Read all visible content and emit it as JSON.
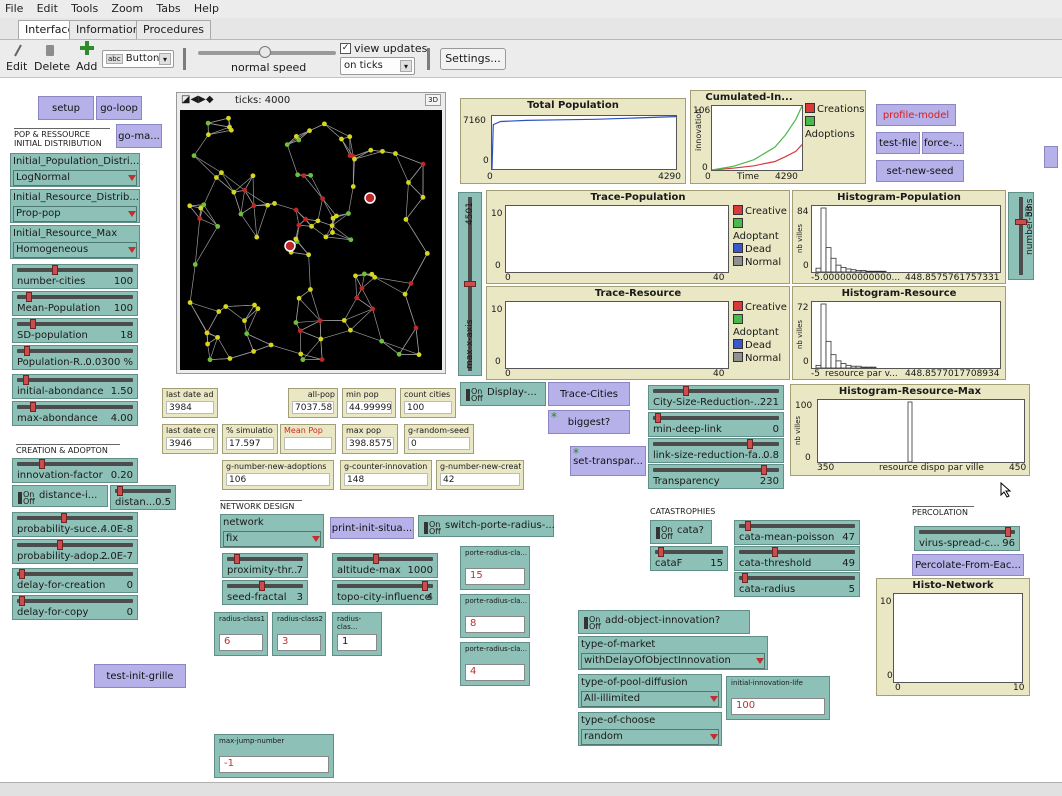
{
  "menu": [
    "File",
    "Edit",
    "Tools",
    "Zoom",
    "Tabs",
    "Help"
  ],
  "tabs": [
    "Interface",
    "Information",
    "Procedures"
  ],
  "toolbar": {
    "edit": "Edit",
    "delete": "Delete",
    "add": "Add",
    "widget_type": "Button",
    "speed_label": "normal speed",
    "view_updates": "view updates",
    "update_mode": "on ticks",
    "settings": "Settings..."
  },
  "world": {
    "ticks_label": "ticks: 4000",
    "three_d": "3D"
  },
  "buttons": {
    "setup": "setup",
    "go_loop": "go-loop",
    "go_ma": "go-ma...",
    "profile_model": "profile-model",
    "test_file": "test-file",
    "force": "force-...",
    "set_new_seed": "set-new-seed",
    "trace_cities": "Trace-Cities",
    "biggest": "biggest?",
    "set_transpar": "set-transpar...",
    "print_init": "print-init-situa...",
    "percolate": "Percolate-From-Eac...",
    "test_init_grille": "test-init-grille"
  },
  "notes": {
    "pop_ressource": "POP & RESSOURCE",
    "initial_distribution": "INITIAL DISTRIBUTION",
    "creation_adoption": "CREATION & ADOPTON",
    "network_design": "NETWORK DESIGN",
    "catastrophies": "CATASTROPHIES",
    "percolation": "PERCOLATION"
  },
  "choosers": {
    "init_pop": {
      "label": "Initial_Population_Distri...",
      "value": "LogNormal"
    },
    "init_res": {
      "label": "Initial_Resource_Distrib...",
      "value": "Prop-pop"
    },
    "init_res_max": {
      "label": "Initial_Resource_Max",
      "value": "Homogeneous"
    },
    "network": {
      "label": "network",
      "value": "fix"
    },
    "type_market": {
      "label": "type-of-market",
      "value": "withDelayOfObjectInnovation"
    },
    "pool_diffusion": {
      "label": "type-of-pool-diffusion",
      "value": "All-illimited"
    },
    "type_choose": {
      "label": "type-of-choose",
      "value": "random"
    }
  },
  "sliders": {
    "number_cities": {
      "name": "number-cities",
      "value": "100",
      "pos": 0.32
    },
    "mean_population": {
      "name": "Mean-Population",
      "value": "100",
      "pos": 0.08
    },
    "sd_population": {
      "name": "SD-population",
      "value": "18",
      "pos": 0.12
    },
    "population_r": {
      "name": "Population-R...",
      "value": "0.0300 %",
      "pos": 0.06
    },
    "initial_abondance": {
      "name": "initial-abondance",
      "value": "1.50",
      "pos": 0.05
    },
    "max_abondance": {
      "name": "max-abondance",
      "value": "4.00",
      "pos": 0.12
    },
    "innovation_factor": {
      "name": "innovation-factor",
      "value": "0.20",
      "pos": 0.2
    },
    "distan": {
      "name": "distan...",
      "value": "0.5",
      "pos": 0.04
    },
    "prob_succ": {
      "name": "probability-suce...",
      "value": "4.0E-8",
      "pos": 0.4
    },
    "prob_adop": {
      "name": "probability-adop...",
      "value": "2.0E-7",
      "pos": 0.36
    },
    "delay_creation": {
      "name": "delay-for-creation",
      "value": "0",
      "pos": 0.02
    },
    "delay_copy": {
      "name": "delay-for-copy",
      "value": "0",
      "pos": 0.02
    },
    "proximity": {
      "name": "proximity-thr...",
      "value": "7",
      "pos": 0.1
    },
    "seed_fractal": {
      "name": "seed-fractal",
      "value": "3",
      "pos": 0.45
    },
    "altitude_max": {
      "name": "altitude-max",
      "value": "1000",
      "pos": 0.4
    },
    "topo_city": {
      "name": "topo-city-influence",
      "value": "4",
      "pos": 0.94
    },
    "city_size_red": {
      "name": "City-Size-Reduction-...",
      "value": "221",
      "pos": 0.25
    },
    "min_deep_link": {
      "name": "min-deep-link",
      "value": "0",
      "pos": 0.02
    },
    "link_size_red": {
      "name": "link-size-reduction-fa...",
      "value": "0.8",
      "pos": 0.78
    },
    "transparency": {
      "name": "Transparency",
      "value": "230",
      "pos": 0.9
    },
    "cata_mean_poisson": {
      "name": "cata-mean-poisson",
      "value": "47",
      "pos": 0.05
    },
    "cata_threshold": {
      "name": "cata-threshold",
      "value": "49",
      "pos": 0.3
    },
    "cata_radius": {
      "name": "cata-radius",
      "value": "5",
      "pos": 0.03
    },
    "cataF": {
      "name": "cataF",
      "value": "15",
      "pos": 0.05
    },
    "virus_spread": {
      "name": "virus-spread-c...",
      "value": "96",
      "pos": 0.95
    }
  },
  "switches": {
    "distance": {
      "name": "distance-i...",
      "on": "On",
      "off": "Off"
    },
    "display": {
      "name": "Display-...",
      "on": "On",
      "off": "Off"
    },
    "porte_radius": {
      "name": "switch-porte-radius-...",
      "on": "On",
      "off": "Off"
    },
    "cata": {
      "name": "cata?",
      "on": "On",
      "off": "Off"
    },
    "add_object": {
      "name": "add-object-innovation?",
      "on": "On",
      "off": "Off"
    }
  },
  "monitors": {
    "last_date_ad": {
      "label": "last date ad",
      "value": "3984"
    },
    "last_date_cre": {
      "label": "last date cre",
      "value": "3946"
    },
    "all_pop": {
      "label": "all-pop",
      "value": "7037.58"
    },
    "min_pop": {
      "label": "min pop",
      "value": "44.9999999"
    },
    "count_cities": {
      "label": "count cities",
      "value": "100"
    },
    "pct_simulation": {
      "label": "% simulatio",
      "value": "17.597"
    },
    "mean_pop": {
      "label": "Mean Pop",
      "value": ""
    },
    "max_pop": {
      "label": "max pop",
      "value": "398.857576"
    },
    "g_random_seed": {
      "label": "g-random-seed",
      "value": "0"
    },
    "g_new_adoptions": {
      "label": "g-number-new-adoptions",
      "value": "106"
    },
    "g_counter_innovation": {
      "label": "g-counter-innovation",
      "value": "148"
    },
    "g_new_creations": {
      "label": "g-number-new-creations",
      "value": "42"
    }
  },
  "inputs": {
    "porte_radius_1": {
      "label": "porte-radius-cla...",
      "value": "15"
    },
    "porte_radius_2": {
      "label": "porte-radius-cla...",
      "value": "8"
    },
    "porte_radius_3": {
      "label": "porte-radius-cla...",
      "value": "4"
    },
    "radius_class1": {
      "label": "radius-class1",
      "value": "6"
    },
    "radius_class2": {
      "label": "radius-class2",
      "value": "3"
    },
    "radius_class3": {
      "label": "radius-clas...",
      "value": "1"
    },
    "initial_innovation_life": {
      "label": "initial-innovation-life",
      "value": "100"
    },
    "max_jump_number": {
      "label": "max-jump-number",
      "value": "-1"
    }
  },
  "vsliders": {
    "max_x_axis": {
      "name": "max-x-axis",
      "value": "4501",
      "pos": 0.5
    },
    "number_bins": {
      "name": "number-bins",
      "value": "38",
      "pos": 0.7
    }
  },
  "plots": {
    "total_population": {
      "title": "Total Population",
      "ymax": "7160",
      "ymin": "0",
      "xmin": "0",
      "xmax": "4290"
    },
    "cumulated": {
      "title": "Cumulated-In...",
      "ymax": "106",
      "ymin": "0",
      "xmin": "0",
      "xmax": "4290",
      "xlabel": "Time",
      "ylabel": "innovation",
      "legend": [
        "Creations",
        "Adoptions"
      ]
    },
    "trace_population": {
      "title": "Trace-Population",
      "ymax": "10",
      "ymin": "0",
      "xmin": "0",
      "xmax": "40",
      "legend": [
        "Creative",
        "Adoptant",
        "Dead",
        "Normal"
      ]
    },
    "histogram_population": {
      "title": "Histogram-Population",
      "ymax": "84",
      "ymin": "0",
      "xmin": "-5.000000000000...",
      "xmax": "448.8575761757331",
      "ylabel": "nb villes"
    },
    "trace_resource": {
      "title": "Trace-Resource",
      "ymax": "10",
      "ymin": "0",
      "xmin": "0",
      "xmax": "40",
      "legend": [
        "Creative",
        "Adoptant",
        "Dead",
        "Normal"
      ]
    },
    "histogram_resource": {
      "title": "Histogram-Resource",
      "ymax": "72",
      "ymin": "0",
      "xmin": "-5",
      "xlabel": "resource par v...",
      "xmax": "448.8577017708934",
      "ylabel": "nb villes"
    },
    "histogram_resource_max": {
      "title": "Histogram-Resource-Max",
      "ymax": "100",
      "ymin": "0",
      "xmin": "350",
      "xlabel": "resource dispo par ville",
      "xmax": "450",
      "ylabel": "nb villes"
    },
    "histo_network": {
      "title": "Histo-Network",
      "ymax": "10",
      "ymin": "0",
      "xmin": "0",
      "xmax": "10"
    }
  },
  "colors": {
    "creative": "#d83a3a",
    "adoptant": "#4cb84c",
    "dead": "#3a56c8",
    "normal": "#909090",
    "creations": "#d83a3a",
    "adoptions": "#4cb84c",
    "population_line": "#3050c0"
  },
  "chart_data": [
    {
      "type": "line",
      "title": "Total Population",
      "xlim": [
        0,
        4290
      ],
      "ylim": [
        0,
        7160
      ],
      "series": [
        {
          "x": [
            0,
            30,
            200,
            800,
            1600,
            2400,
            3200,
            4000,
            4290
          ],
          "values": [
            0,
            6000,
            6420,
            6560,
            6640,
            6720,
            6860,
            7030,
            7080
          ]
        }
      ]
    },
    {
      "type": "line",
      "title": "Cumulated-In...",
      "xlabel": "Time",
      "ylabel": "innovation",
      "xlim": [
        0,
        4290
      ],
      "ylim": [
        0,
        106
      ],
      "series": [
        {
          "name": "Creations",
          "x": [
            0,
            1000,
            2000,
            3000,
            3500,
            4000,
            4290
          ],
          "values": [
            0,
            3,
            7,
            14,
            22,
            31,
            42
          ]
        },
        {
          "name": "Adoptions",
          "x": [
            0,
            1000,
            2000,
            3000,
            3500,
            4000,
            4290
          ],
          "values": [
            0,
            6,
            17,
            38,
            58,
            84,
            106
          ]
        }
      ]
    },
    {
      "type": "bar",
      "title": "Histogram-Population",
      "ylabel": "nb villes",
      "xlim": [
        -5,
        448.86
      ],
      "ylim": [
        0,
        84
      ],
      "values": [
        5,
        84,
        32,
        18,
        9,
        6,
        4,
        3,
        2,
        2,
        1,
        1,
        1,
        1
      ]
    },
    {
      "type": "bar",
      "title": "Histogram-Resource",
      "xlabel": "resource par v...",
      "ylabel": "nb villes",
      "xlim": [
        -5,
        448.86
      ],
      "ylim": [
        0,
        72
      ],
      "values": [
        3,
        72,
        30,
        15,
        8,
        5,
        3,
        2,
        2,
        1,
        1,
        1
      ]
    },
    {
      "type": "bar",
      "title": "Histogram-Resource-Max",
      "xlabel": "resource dispo par ville",
      "ylabel": "nb villes",
      "xlim": [
        350,
        450
      ],
      "ylim": [
        0,
        100
      ],
      "values": [
        100
      ]
    }
  ]
}
